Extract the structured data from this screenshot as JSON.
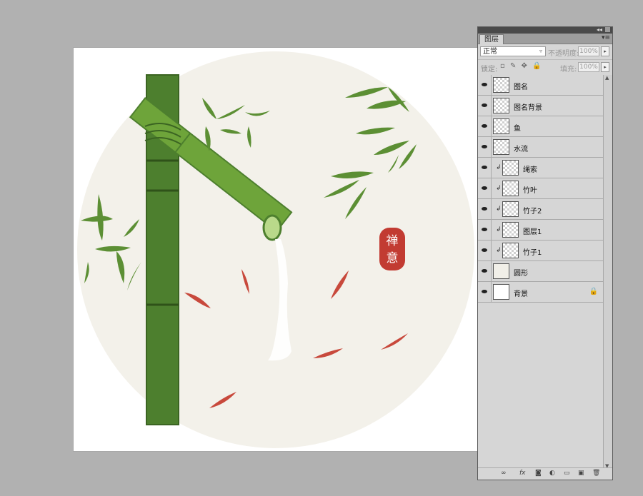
{
  "panel": {
    "tab_label": "图层",
    "blend_mode": "正常",
    "opacity_label": "不透明度:",
    "opacity_value": "100%",
    "lock_label": "锁定:",
    "fill_label": "填充:",
    "fill_value": "100%"
  },
  "layers": [
    {
      "name": "图名"
    },
    {
      "name": "图名背景"
    },
    {
      "name": "鱼"
    },
    {
      "name": "水流"
    },
    {
      "name": "绳索"
    },
    {
      "name": "竹叶"
    },
    {
      "name": "竹子2"
    },
    {
      "name": "图层1"
    },
    {
      "name": "竹子1"
    },
    {
      "name": "圆形"
    },
    {
      "name": "背景"
    }
  ],
  "artwork": {
    "seal_chars": [
      "禅",
      "意"
    ],
    "colors": {
      "circle": "#f3f1ea",
      "bamboo": "#4d7f2e",
      "bamboo_light": "#6ea43a",
      "fish": "#c8493c",
      "seal": "#c23b32",
      "leaf": "#5c8f34"
    }
  },
  "icons": {
    "visibility": "eye-icon",
    "collapse": "double-chevron-icon",
    "panel_menu": "panel-menu-icon",
    "lock": "lock-icon",
    "link": "link-layers-icon",
    "fx": "fx-icon",
    "mask": "mask-icon",
    "adjustment": "adjustment-icon",
    "group": "folder-icon",
    "new_layer": "new-layer-icon",
    "delete": "trash-icon"
  }
}
